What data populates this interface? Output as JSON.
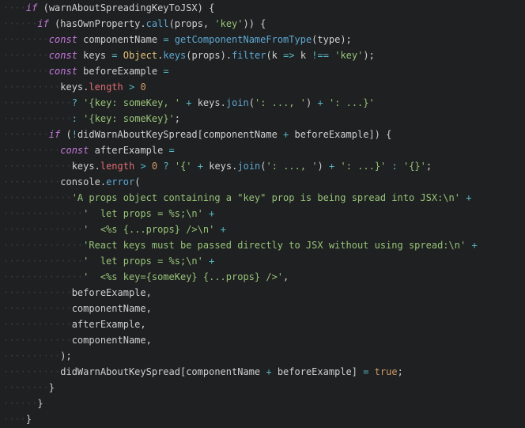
{
  "code": {
    "lines": [
      [
        [
          "ws",
          "····"
        ],
        [
          "kw",
          "if"
        ],
        [
          "pn",
          " ("
        ],
        [
          "id",
          "warnAboutSpreadingKeyToJSX"
        ],
        [
          "pn",
          ") {"
        ]
      ],
      [
        [
          "ws",
          "······"
        ],
        [
          "kw",
          "if"
        ],
        [
          "pn",
          " ("
        ],
        [
          "id",
          "hasOwnProperty"
        ],
        [
          "pn",
          "."
        ],
        [
          "fn",
          "call"
        ],
        [
          "pn",
          "("
        ],
        [
          "id",
          "props"
        ],
        [
          "pn",
          ", "
        ],
        [
          "str",
          "'key'"
        ],
        [
          "pn",
          ")) {"
        ]
      ],
      [
        [
          "ws",
          "········"
        ],
        [
          "dec",
          "const"
        ],
        [
          "pn",
          " "
        ],
        [
          "id",
          "componentName"
        ],
        [
          "pn",
          " "
        ],
        [
          "op",
          "="
        ],
        [
          "pn",
          " "
        ],
        [
          "fn",
          "getComponentNameFromType"
        ],
        [
          "pn",
          "("
        ],
        [
          "id",
          "type"
        ],
        [
          "pn",
          ");"
        ]
      ],
      [
        [
          "ws",
          "········"
        ],
        [
          "dec",
          "const"
        ],
        [
          "pn",
          " "
        ],
        [
          "id",
          "keys"
        ],
        [
          "pn",
          " "
        ],
        [
          "op",
          "="
        ],
        [
          "pn",
          " "
        ],
        [
          "cls",
          "Object"
        ],
        [
          "pn",
          "."
        ],
        [
          "fn",
          "keys"
        ],
        [
          "pn",
          "("
        ],
        [
          "id",
          "props"
        ],
        [
          "pn",
          ")."
        ],
        [
          "fn",
          "filter"
        ],
        [
          "pn",
          "("
        ],
        [
          "id",
          "k"
        ],
        [
          "pn",
          " "
        ],
        [
          "op",
          "=>"
        ],
        [
          "pn",
          " "
        ],
        [
          "id",
          "k"
        ],
        [
          "pn",
          " "
        ],
        [
          "op",
          "!=="
        ],
        [
          "pn",
          " "
        ],
        [
          "str",
          "'key'"
        ],
        [
          "pn",
          ");"
        ]
      ],
      [
        [
          "ws",
          "········"
        ],
        [
          "dec",
          "const"
        ],
        [
          "pn",
          " "
        ],
        [
          "id",
          "beforeExample"
        ],
        [
          "pn",
          " "
        ],
        [
          "op",
          "="
        ]
      ],
      [
        [
          "ws",
          "··········"
        ],
        [
          "id",
          "keys"
        ],
        [
          "pn",
          "."
        ],
        [
          "prop",
          "length"
        ],
        [
          "pn",
          " "
        ],
        [
          "op",
          ">"
        ],
        [
          "pn",
          " "
        ],
        [
          "num",
          "0"
        ]
      ],
      [
        [
          "ws",
          "············"
        ],
        [
          "op",
          "?"
        ],
        [
          "pn",
          " "
        ],
        [
          "str",
          "'{key: someKey, '"
        ],
        [
          "pn",
          " "
        ],
        [
          "op",
          "+"
        ],
        [
          "pn",
          " "
        ],
        [
          "id",
          "keys"
        ],
        [
          "pn",
          "."
        ],
        [
          "fn",
          "join"
        ],
        [
          "pn",
          "("
        ],
        [
          "str",
          "': ..., '"
        ],
        [
          "pn",
          ") "
        ],
        [
          "op",
          "+"
        ],
        [
          "pn",
          " "
        ],
        [
          "str",
          "': ...}'"
        ]
      ],
      [
        [
          "ws",
          "············"
        ],
        [
          "op",
          ":"
        ],
        [
          "pn",
          " "
        ],
        [
          "str",
          "'{key: someKey}'"
        ],
        [
          "pn",
          ";"
        ]
      ],
      [
        [
          "ws",
          "········"
        ],
        [
          "kw",
          "if"
        ],
        [
          "pn",
          " ("
        ],
        [
          "op",
          "!"
        ],
        [
          "id",
          "didWarnAboutKeySpread"
        ],
        [
          "pn",
          "["
        ],
        [
          "id",
          "componentName"
        ],
        [
          "pn",
          " "
        ],
        [
          "op",
          "+"
        ],
        [
          "pn",
          " "
        ],
        [
          "id",
          "beforeExample"
        ],
        [
          "pn",
          "]) {"
        ]
      ],
      [
        [
          "ws",
          "··········"
        ],
        [
          "dec",
          "const"
        ],
        [
          "pn",
          " "
        ],
        [
          "id",
          "afterExample"
        ],
        [
          "pn",
          " "
        ],
        [
          "op",
          "="
        ]
      ],
      [
        [
          "ws",
          "············"
        ],
        [
          "id",
          "keys"
        ],
        [
          "pn",
          "."
        ],
        [
          "prop",
          "length"
        ],
        [
          "pn",
          " "
        ],
        [
          "op",
          ">"
        ],
        [
          "pn",
          " "
        ],
        [
          "num",
          "0"
        ],
        [
          "pn",
          " "
        ],
        [
          "op",
          "?"
        ],
        [
          "pn",
          " "
        ],
        [
          "str",
          "'{'"
        ],
        [
          "pn",
          " "
        ],
        [
          "op",
          "+"
        ],
        [
          "pn",
          " "
        ],
        [
          "id",
          "keys"
        ],
        [
          "pn",
          "."
        ],
        [
          "fn",
          "join"
        ],
        [
          "pn",
          "("
        ],
        [
          "str",
          "': ..., '"
        ],
        [
          "pn",
          ") "
        ],
        [
          "op",
          "+"
        ],
        [
          "pn",
          " "
        ],
        [
          "str",
          "': ...}'"
        ],
        [
          "pn",
          " "
        ],
        [
          "op",
          ":"
        ],
        [
          "pn",
          " "
        ],
        [
          "str",
          "'{}'"
        ],
        [
          "pn",
          ";"
        ]
      ],
      [
        [
          "ws",
          "··········"
        ],
        [
          "id",
          "console"
        ],
        [
          "pn",
          "."
        ],
        [
          "fn",
          "error"
        ],
        [
          "pn",
          "("
        ]
      ],
      [
        [
          "ws",
          "············"
        ],
        [
          "str",
          "'A props object containing a \"key\" prop is being spread into JSX:\\n'"
        ],
        [
          "pn",
          " "
        ],
        [
          "op",
          "+"
        ]
      ],
      [
        [
          "ws",
          "··············"
        ],
        [
          "str",
          "'  let props = %s;\\n'"
        ],
        [
          "pn",
          " "
        ],
        [
          "op",
          "+"
        ]
      ],
      [
        [
          "ws",
          "··············"
        ],
        [
          "str",
          "'  <%s {...props} />\\n'"
        ],
        [
          "pn",
          " "
        ],
        [
          "op",
          "+"
        ]
      ],
      [
        [
          "ws",
          "··············"
        ],
        [
          "str",
          "'React keys must be passed directly to JSX without using spread:\\n'"
        ],
        [
          "pn",
          " "
        ],
        [
          "op",
          "+"
        ]
      ],
      [
        [
          "ws",
          "··············"
        ],
        [
          "str",
          "'  let props = %s;\\n'"
        ],
        [
          "pn",
          " "
        ],
        [
          "op",
          "+"
        ]
      ],
      [
        [
          "ws",
          "··············"
        ],
        [
          "str",
          "'  <%s key={someKey} {...props} />'"
        ],
        [
          "pn",
          ","
        ]
      ],
      [
        [
          "ws",
          "············"
        ],
        [
          "id",
          "beforeExample"
        ],
        [
          "pn",
          ","
        ]
      ],
      [
        [
          "ws",
          "············"
        ],
        [
          "id",
          "componentName"
        ],
        [
          "pn",
          ","
        ]
      ],
      [
        [
          "ws",
          "············"
        ],
        [
          "id",
          "afterExample"
        ],
        [
          "pn",
          ","
        ]
      ],
      [
        [
          "ws",
          "············"
        ],
        [
          "id",
          "componentName"
        ],
        [
          "pn",
          ","
        ]
      ],
      [
        [
          "ws",
          "··········"
        ],
        [
          "pn",
          ");"
        ]
      ],
      [
        [
          "ws",
          "··········"
        ],
        [
          "id",
          "didWarnAboutKeySpread"
        ],
        [
          "pn",
          "["
        ],
        [
          "id",
          "componentName"
        ],
        [
          "pn",
          " "
        ],
        [
          "op",
          "+"
        ],
        [
          "pn",
          " "
        ],
        [
          "id",
          "beforeExample"
        ],
        [
          "pn",
          "] "
        ],
        [
          "op",
          "="
        ],
        [
          "pn",
          " "
        ],
        [
          "bool",
          "true"
        ],
        [
          "pn",
          ";"
        ]
      ],
      [
        [
          "ws",
          "········"
        ],
        [
          "pn",
          "}"
        ]
      ],
      [
        [
          "ws",
          "······"
        ],
        [
          "pn",
          "}"
        ]
      ],
      [
        [
          "ws",
          "····"
        ],
        [
          "pn",
          "}"
        ]
      ]
    ]
  }
}
